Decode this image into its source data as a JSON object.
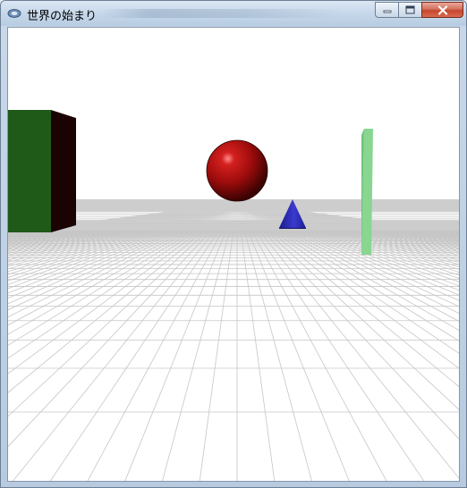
{
  "window": {
    "title": "世界の始まり",
    "buttons": {
      "minimize": "minimize",
      "maximize": "maximize",
      "close": "close"
    }
  },
  "scene": {
    "objects": [
      "green-cube",
      "red-sphere",
      "blue-cone",
      "green-pillar"
    ],
    "colors": {
      "background": "#ffffff",
      "horizon_band": "#cccccc",
      "grid": "#c8c8c8",
      "cube_front": "#1f5a18",
      "cube_side": "#1a0302",
      "sphere": "#a40d0d",
      "cone": "#2828a8",
      "pillar": "#86d48f"
    }
  }
}
